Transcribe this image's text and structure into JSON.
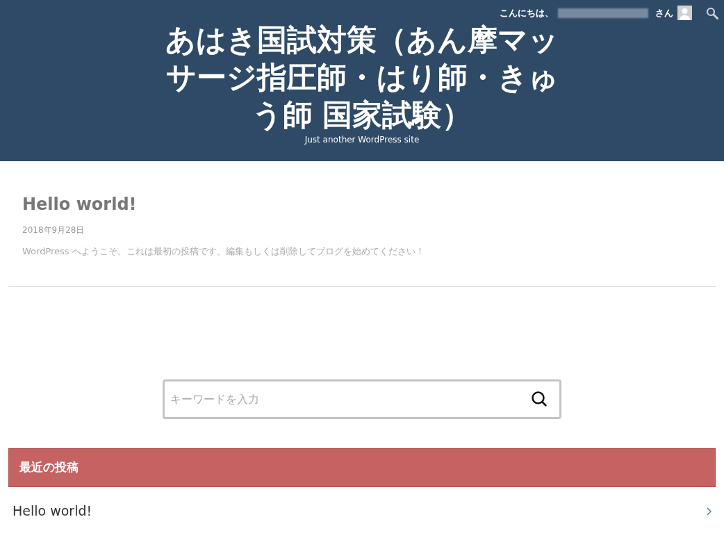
{
  "header": {
    "greeting": "こんにちは、",
    "greeting_suffix": "さん",
    "title": "あはき国試対策（あん摩マッサージ指圧師・はり師・きゅう師 国家試験）",
    "tagline": "Just another WordPress site"
  },
  "post": {
    "title": "Hello world!",
    "date": "2018年9月28日",
    "excerpt": "WordPress へようこそ。これは最初の投稿です。編集もしくは削除してブログを始めてください！"
  },
  "search": {
    "placeholder": "キーワードを入力"
  },
  "recent_posts": {
    "heading": "最近の投稿",
    "items": [
      {
        "title": "Hello world!"
      }
    ]
  }
}
